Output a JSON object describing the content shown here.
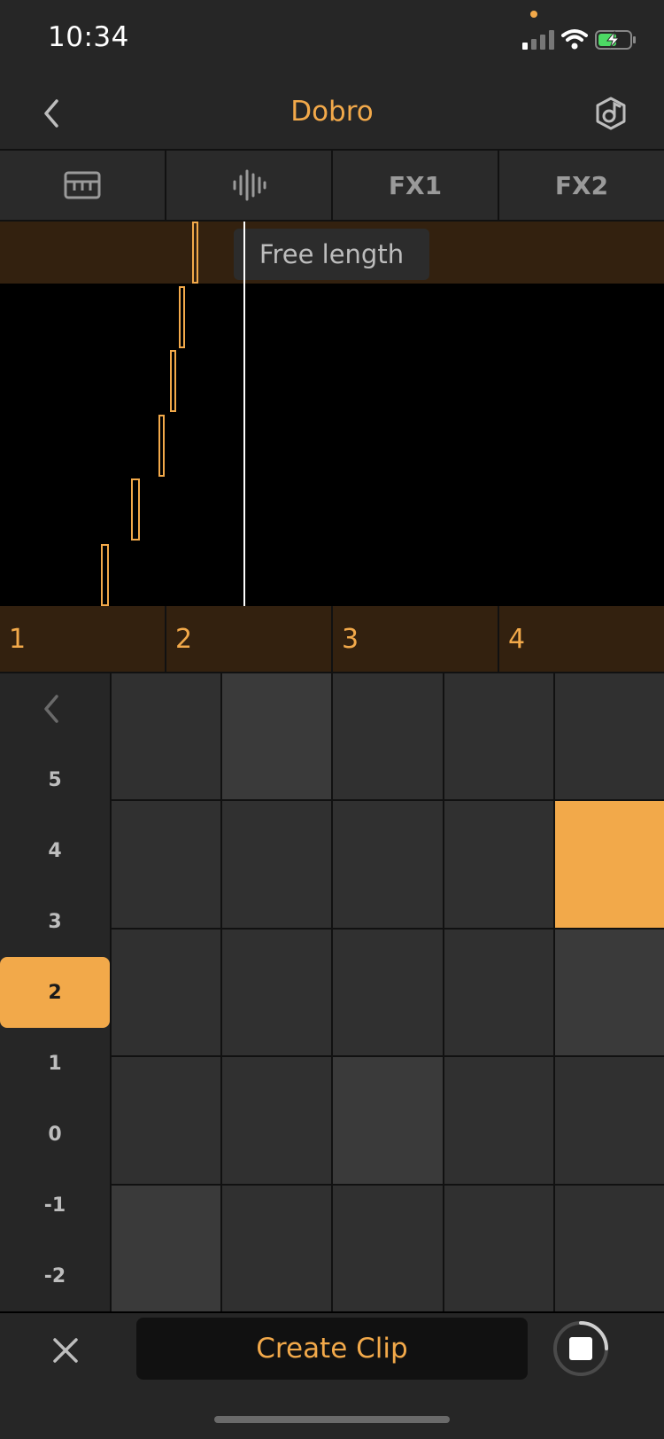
{
  "status_bar": {
    "time": "10:34"
  },
  "header": {
    "title": "Dobro"
  },
  "tabs": [
    {
      "type": "icon",
      "icon": "keyboard-icon"
    },
    {
      "type": "icon",
      "icon": "waveform-icon"
    },
    {
      "type": "text",
      "label": "FX1"
    },
    {
      "type": "text",
      "label": "FX2"
    }
  ],
  "clip": {
    "length_label": "Free length"
  },
  "ruler": {
    "bars": [
      "1",
      "2",
      "3",
      "4"
    ]
  },
  "octaves": {
    "labels": [
      "5",
      "4",
      "3",
      "2",
      "1",
      "0",
      "-1",
      "-2"
    ],
    "selected": "2"
  },
  "pads": {
    "rows": 5,
    "cols": 5,
    "active": [
      {
        "row": 2,
        "col": 5
      }
    ]
  },
  "bottom_bar": {
    "create_label": "Create Clip"
  },
  "colors": {
    "accent": "#F2A94A",
    "panel": "#262626",
    "pad": "#303030",
    "strip": "#33210F"
  }
}
